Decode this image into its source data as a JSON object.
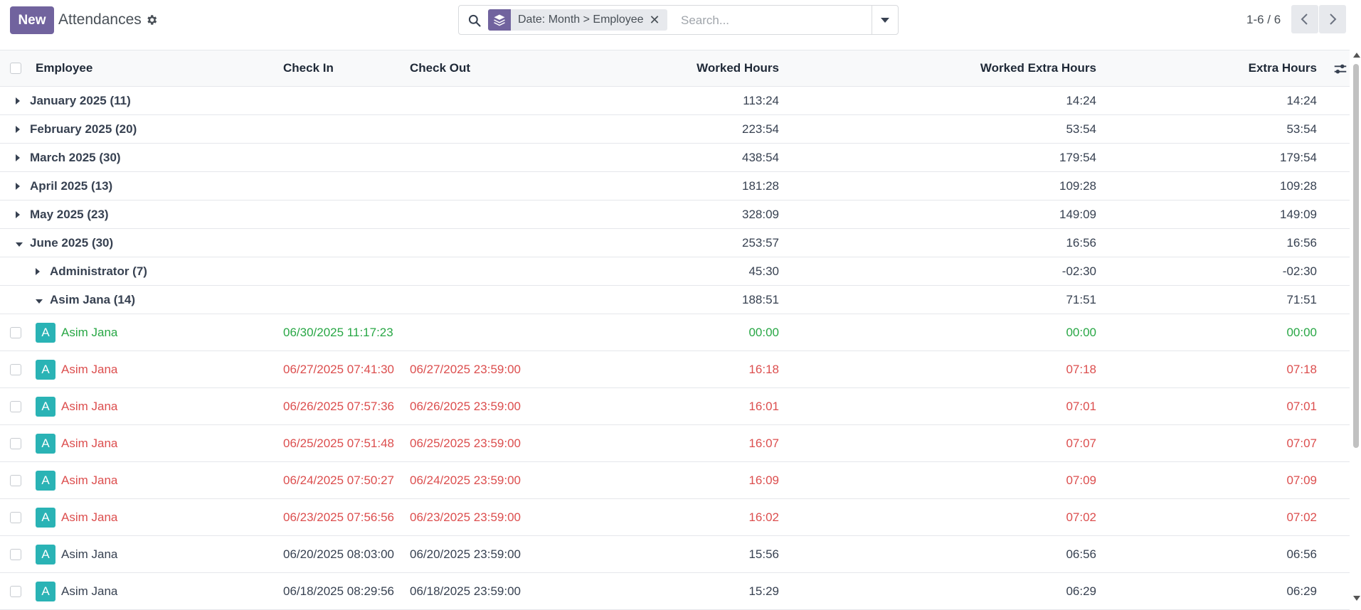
{
  "toolbar": {
    "new_label": "New",
    "title": "Attendances",
    "gear_icon": "gear-icon"
  },
  "search": {
    "facet_label": "Date: Month > Employee",
    "facet_icon": "layers-icon",
    "placeholder": "Search...",
    "value": ""
  },
  "pager": {
    "range": "1-6 / 6"
  },
  "columns": {
    "employee": "Employee",
    "check_in": "Check In",
    "check_out": "Check Out",
    "worked_hours": "Worked Hours",
    "worked_extra_hours": "Worked Extra Hours",
    "extra_hours": "Extra Hours"
  },
  "groups": [
    {
      "label": "January 2025 (11)",
      "worked": "113:24",
      "worked_extra": "14:24",
      "extra": "14:24"
    },
    {
      "label": "February 2025 (20)",
      "worked": "223:54",
      "worked_extra": "53:54",
      "extra": "53:54"
    },
    {
      "label": "March 2025 (30)",
      "worked": "438:54",
      "worked_extra": "179:54",
      "extra": "179:54"
    },
    {
      "label": "April 2025 (13)",
      "worked": "181:28",
      "worked_extra": "109:28",
      "extra": "109:28"
    },
    {
      "label": "May 2025 (23)",
      "worked": "328:09",
      "worked_extra": "149:09",
      "extra": "149:09"
    },
    {
      "label": "June 2025 (30)",
      "worked": "253:57",
      "worked_extra": "16:56",
      "extra": "16:56"
    }
  ],
  "subgroups": [
    {
      "label": "Administrator (7)",
      "worked": "45:30",
      "worked_extra": "-02:30",
      "extra": "-02:30"
    },
    {
      "label": "Asim Jana (14)",
      "worked": "188:51",
      "worked_extra": "71:51",
      "extra": "71:51"
    }
  ],
  "records": [
    {
      "avatar": "A",
      "employee": "Asim Jana",
      "check_in": "06/30/2025 11:17:23",
      "check_out": "",
      "worked": "00:00",
      "worked_extra": "00:00",
      "extra": "00:00",
      "status": "green"
    },
    {
      "avatar": "A",
      "employee": "Asim Jana",
      "check_in": "06/27/2025 07:41:30",
      "check_out": "06/27/2025 23:59:00",
      "worked": "16:18",
      "worked_extra": "07:18",
      "extra": "07:18",
      "status": "red"
    },
    {
      "avatar": "A",
      "employee": "Asim Jana",
      "check_in": "06/26/2025 07:57:36",
      "check_out": "06/26/2025 23:59:00",
      "worked": "16:01",
      "worked_extra": "07:01",
      "extra": "07:01",
      "status": "red"
    },
    {
      "avatar": "A",
      "employee": "Asim Jana",
      "check_in": "06/25/2025 07:51:48",
      "check_out": "06/25/2025 23:59:00",
      "worked": "16:07",
      "worked_extra": "07:07",
      "extra": "07:07",
      "status": "red"
    },
    {
      "avatar": "A",
      "employee": "Asim Jana",
      "check_in": "06/24/2025 07:50:27",
      "check_out": "06/24/2025 23:59:00",
      "worked": "16:09",
      "worked_extra": "07:09",
      "extra": "07:09",
      "status": "red"
    },
    {
      "avatar": "A",
      "employee": "Asim Jana",
      "check_in": "06/23/2025 07:56:56",
      "check_out": "06/23/2025 23:59:00",
      "worked": "16:02",
      "worked_extra": "07:02",
      "extra": "07:02",
      "status": "red"
    },
    {
      "avatar": "A",
      "employee": "Asim Jana",
      "check_in": "06/20/2025 08:03:00",
      "check_out": "06/20/2025 23:59:00",
      "worked": "15:56",
      "worked_extra": "06:56",
      "extra": "06:56",
      "status": "normal"
    },
    {
      "avatar": "A",
      "employee": "Asim Jana",
      "check_in": "06/18/2025 08:29:56",
      "check_out": "06/18/2025 23:59:00",
      "worked": "15:29",
      "worked_extra": "06:29",
      "extra": "06:29",
      "status": "normal"
    }
  ],
  "colors": {
    "brand": "#71639e",
    "avatar": "#2ab3b5",
    "green": "#28a745",
    "red": "#dc4e4e"
  }
}
